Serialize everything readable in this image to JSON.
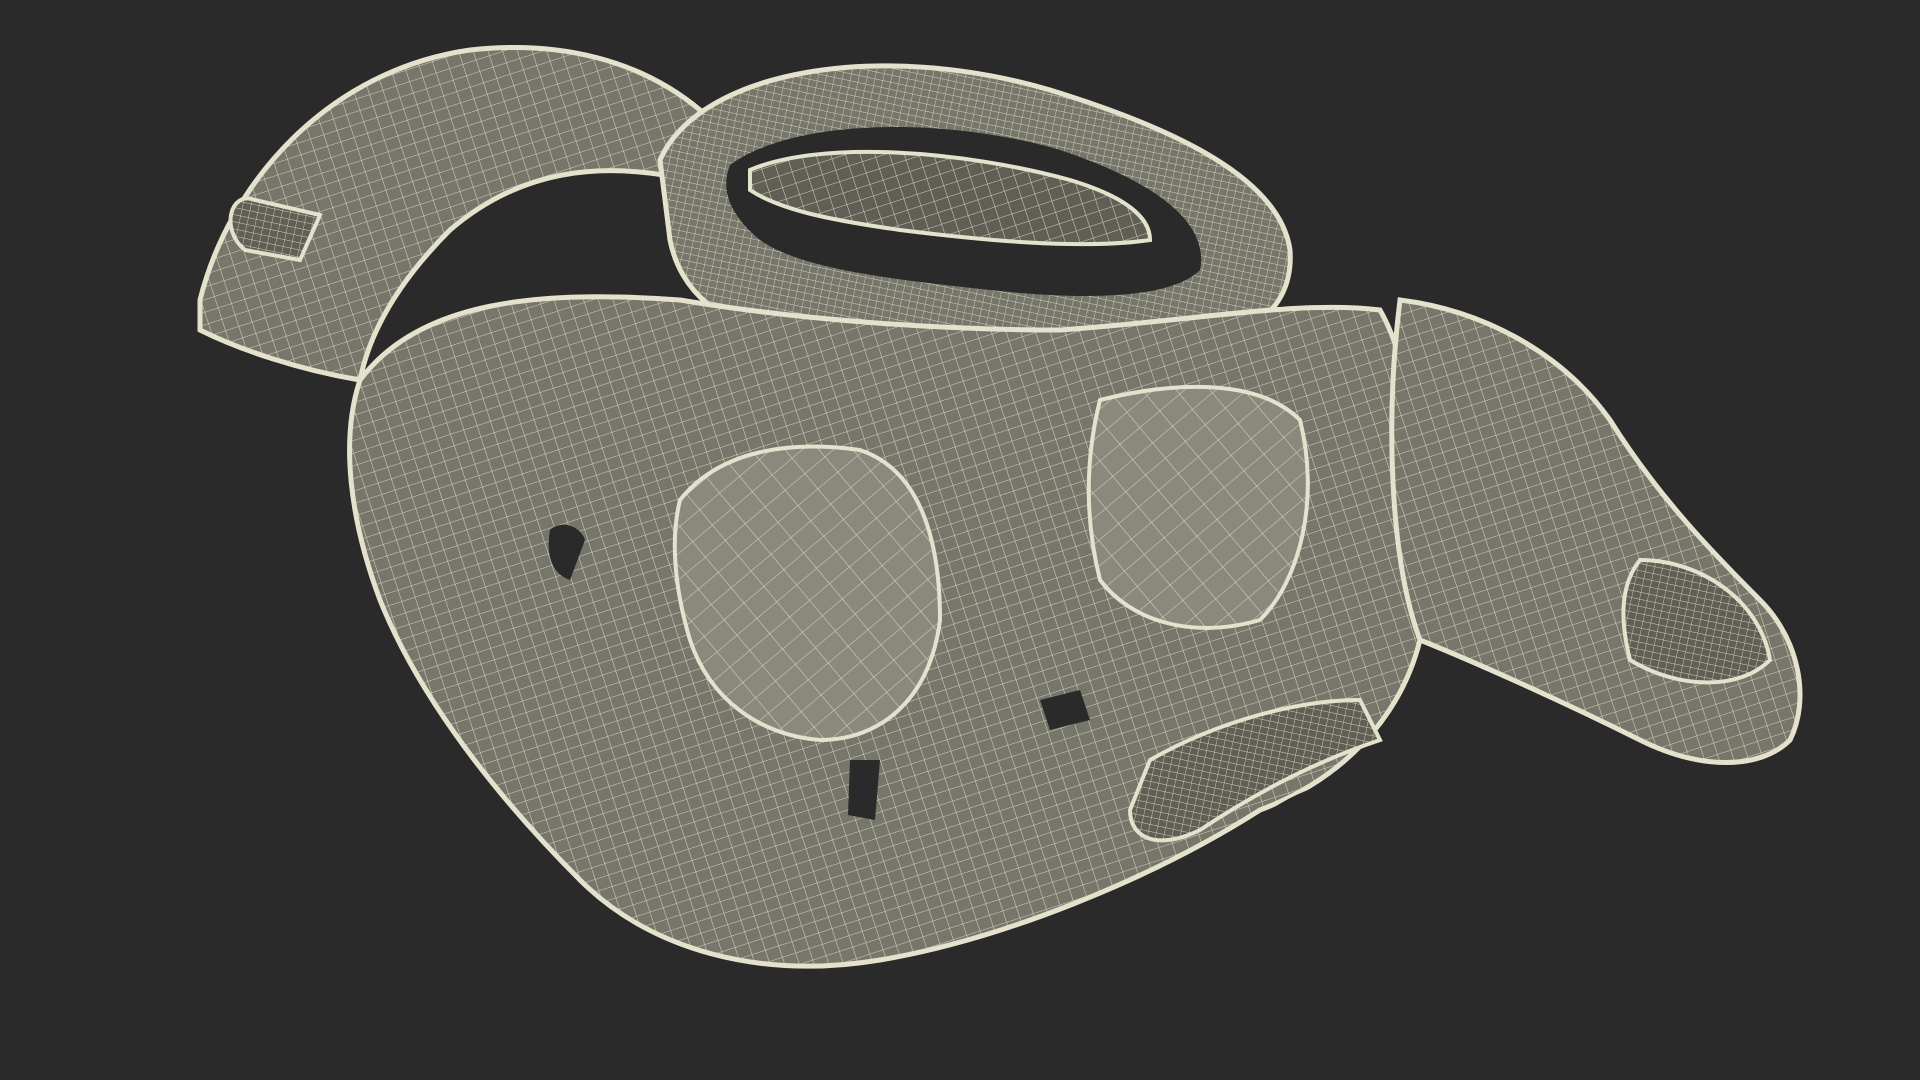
{
  "scene": {
    "subject": "shoulder-pads-wireframe-render",
    "background_color": "#2a2a2a",
    "colors": {
      "surface": "#76766a",
      "surface_shadow": "#5f5f55",
      "surface_light": "#8a8a7c",
      "wire": "#e4e2cc",
      "opening": "#2a2a2a"
    }
  }
}
